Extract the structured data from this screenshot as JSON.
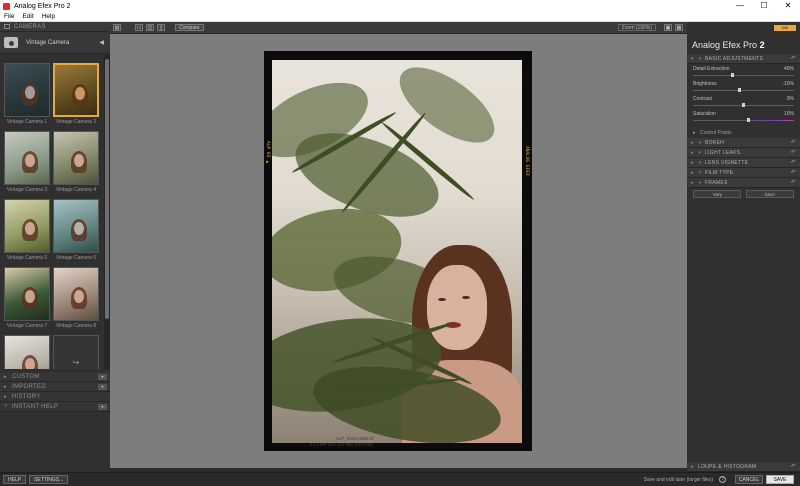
{
  "window": {
    "title": "Analog Efex Pro 2",
    "minimize": "—",
    "maximize": "☐",
    "close": "✕"
  },
  "menu": [
    "File",
    "Edit",
    "Help"
  ],
  "left_panel": {
    "header": "CAMERAS",
    "camera_selector": "Vintage Camera",
    "thumbnails": [
      {
        "label": "Vintage Camera 1"
      },
      {
        "label": "Vintage Camera 2"
      },
      {
        "label": "Vintage Camera 3"
      },
      {
        "label": "Vintage Camera 4"
      },
      {
        "label": "Vintage Camera 5"
      },
      {
        "label": "Vintage Camera 6"
      },
      {
        "label": "Vintage Camera 7"
      },
      {
        "label": "Vintage Camera 8"
      }
    ],
    "selected_index": 1,
    "sections": [
      "CUSTOM",
      "IMPORTED",
      "HISTORY",
      "INSTANT HELP"
    ]
  },
  "toolbar": {
    "compare": "Compare",
    "zoom": "Zoom (100%)"
  },
  "canvas": {
    "film_code_left": "ALP 03 ▶",
    "film_code_right": "ANALOG EFEX",
    "caption_line1": "ALP_0333-0480.tif",
    "caption_line2": "24.2 MP ISO 100 NIK KAI 5760"
  },
  "right_panel": {
    "brand_badge": "NIK COLLECTION",
    "title_main": "Analog Efex Pro",
    "title_version": "2",
    "basic_adjustments": {
      "header": "BASIC ADJUSTMENTS",
      "sliders": [
        {
          "label": "Detail Extraction",
          "value": "40%"
        },
        {
          "label": "Brightness",
          "value": "-10%"
        },
        {
          "label": "Contrast",
          "value": "0%"
        },
        {
          "label": "Saturation",
          "value": "10%"
        }
      ],
      "control_points": "Control Points"
    },
    "sections": [
      "BOKEH",
      "LIGHT LEAKS",
      "LENS VIGNETTE",
      "FILM TYPE",
      "FRAMES"
    ],
    "frames_buttons": [
      "Vary",
      "Save"
    ],
    "loupe": "LOUPE & HISTOGRAM"
  },
  "bottombar": {
    "help": "HELP",
    "settings": "SETTINGS...",
    "note": "Save and edit later (larger files)",
    "cancel": "CANCEL",
    "save": "SAVE"
  }
}
